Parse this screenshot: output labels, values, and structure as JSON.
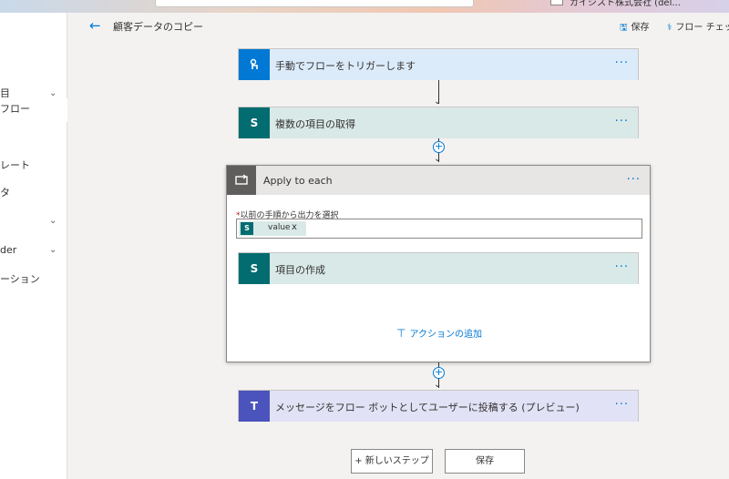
{
  "topbar": {
    "account_text": "ガイジスト株式会社 (del..."
  },
  "leftnav": {
    "items": [
      {
        "label": "目",
        "chevron": "chevron-down-icon"
      },
      {
        "label": "フロー",
        "active": true
      },
      {
        "label": "レート"
      },
      {
        "label": "タ"
      },
      {
        "label": "",
        "chevron": "chevron-down-icon"
      },
      {
        "label": "der",
        "chevron": "chevron-down-icon"
      },
      {
        "label": "ーション"
      }
    ]
  },
  "header": {
    "title": "顧客データのコピー",
    "save_label": "保存",
    "checker_label": "フロー チェッカ"
  },
  "flow": {
    "trigger": {
      "title": "手動でフローをトリガーします",
      "more": "···"
    },
    "get_items": {
      "title": "複数の項目の取得",
      "more": "···"
    },
    "apply_to_each": {
      "title": "Apply to each",
      "more": "···",
      "field_label_required": "*",
      "field_label": "以前の手順から出力を選択",
      "token_label": "value",
      "token_remove": "x",
      "inner_action": {
        "title": "項目の作成",
        "more": "···"
      },
      "add_action_label": "アクションの追加"
    },
    "teams_post": {
      "title": "メッセージをフロー ボットとしてユーザーに投稿する (プレビュー)",
      "more": "···"
    }
  },
  "footer": {
    "new_step_label": "+ 新しいステップ",
    "save_label": "保存"
  },
  "colors": {
    "accent": "#0078d4",
    "sharepoint": "#036c70",
    "teams": "#4b53bc",
    "trigger_header": "#dcebfa",
    "sharepoint_header": "#d9e9e7",
    "teams_header": "#e2e2f6"
  }
}
